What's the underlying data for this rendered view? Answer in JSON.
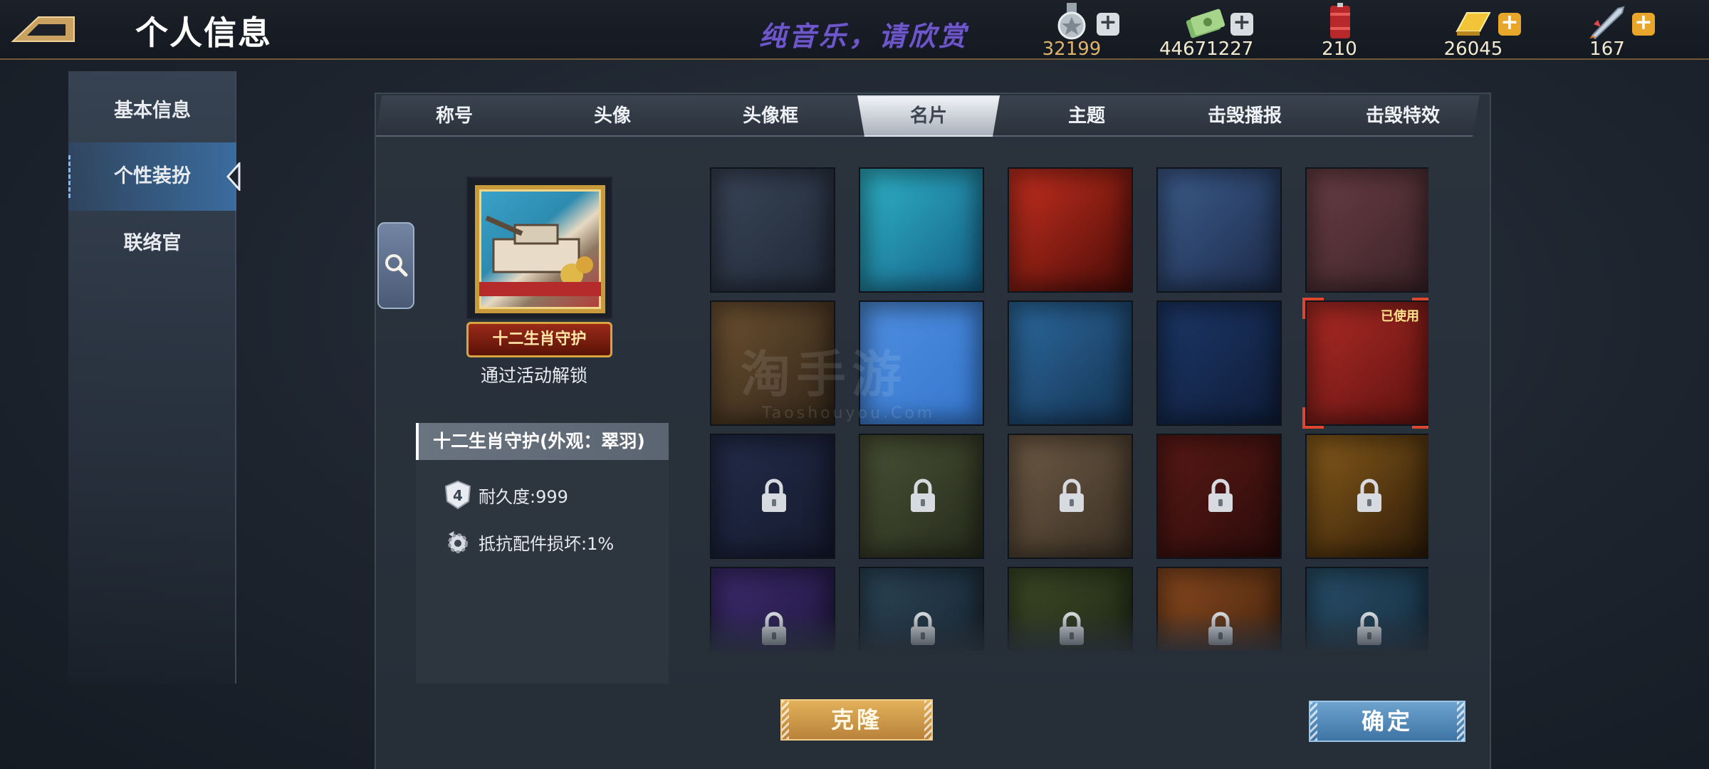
{
  "header": {
    "title": "个人信息",
    "music_text": "纯音乐，请欣赏",
    "resources": [
      {
        "icon": "medal-icon",
        "value": "32199",
        "value_color": "#e0b36a"
      },
      {
        "icon": "cash-icon",
        "value": "44671227",
        "value_color": "#f3ead0"
      },
      {
        "icon": "fuel-barrel-icon",
        "value": "210",
        "value_color": "#f3ead0"
      },
      {
        "icon": "gold-bar-icon",
        "value": "26045",
        "value_color": "#f3ead0"
      },
      {
        "icon": "rocket-icon",
        "value": "167",
        "value_color": "#f3ead0"
      }
    ]
  },
  "sidebar": {
    "items": [
      {
        "label": "基本信息",
        "active": false
      },
      {
        "label": "个性装扮",
        "active": true
      },
      {
        "label": "联络官",
        "active": false
      }
    ]
  },
  "tabs": [
    {
      "label": "称号",
      "active": false
    },
    {
      "label": "头像",
      "active": false
    },
    {
      "label": "头像框",
      "active": false
    },
    {
      "label": "名片",
      "active": true
    },
    {
      "label": "主题",
      "active": false
    },
    {
      "label": "击毁播报",
      "active": false
    },
    {
      "label": "击毁特效",
      "active": false
    }
  ],
  "preview": {
    "banner_text": "十二生肖守护",
    "unlock_text": "通过活动解锁"
  },
  "info": {
    "title": "十二生肖守护(外观：翠羽)",
    "stats": [
      {
        "icon": "durability-shield-icon",
        "text": "耐久度:999"
      },
      {
        "icon": "gear-damage-icon",
        "text": "抵抗配件损坏:1%"
      }
    ]
  },
  "cards": [
    {
      "name": "hexagon-steel",
      "locked": false,
      "colors": [
        "#3a4658",
        "#1f2836"
      ]
    },
    {
      "name": "ocean",
      "locked": false,
      "colors": [
        "#2fb5c9",
        "#155e86"
      ]
    },
    {
      "name": "red-flag",
      "locked": false,
      "colors": [
        "#c8301f",
        "#4a0c08"
      ]
    },
    {
      "name": "blue-checker",
      "locked": false,
      "colors": [
        "#3e5d8d",
        "#1b2a48"
      ]
    },
    {
      "name": "purple-swirl",
      "locked": false,
      "colors": [
        "#6a3f45",
        "#3a2228"
      ]
    },
    {
      "name": "brown-stripes",
      "locked": false,
      "colors": [
        "#6f5232",
        "#2f2418"
      ]
    },
    {
      "name": "blue-pattern",
      "locked": false,
      "colors": [
        "#4f8fe0",
        "#3577cf"
      ]
    },
    {
      "name": "blue-floral",
      "locked": false,
      "colors": [
        "#2c6a9e",
        "#153353"
      ]
    },
    {
      "name": "navy-wave",
      "locked": false,
      "colors": [
        "#1c3766",
        "#0f1d3a"
      ]
    },
    {
      "name": "red-cloud",
      "locked": false,
      "used": true,
      "used_label": "已使用",
      "colors": [
        "#b02b25",
        "#5d1210"
      ]
    },
    {
      "name": "star-dark",
      "locked": true,
      "colors": [
        "#232c4a",
        "#141a2e"
      ]
    },
    {
      "name": "camo-green",
      "locked": true,
      "colors": [
        "#4a5236",
        "#262b1c"
      ]
    },
    {
      "name": "tan-stripes",
      "locked": true,
      "colors": [
        "#6e5b45",
        "#3a2f24"
      ]
    },
    {
      "name": "dark-red",
      "locked": true,
      "colors": [
        "#5b1a17",
        "#2a0b0a"
      ]
    },
    {
      "name": "amber-glow",
      "locked": true,
      "colors": [
        "#8a5d1b",
        "#2c1a08"
      ]
    },
    {
      "name": "purple-night",
      "locked": true,
      "colors": [
        "#3c2b6e",
        "#1d153a"
      ]
    },
    {
      "name": "helicopter",
      "locked": true,
      "colors": [
        "#2c4658",
        "#14212c"
      ]
    },
    {
      "name": "green-leaf",
      "locked": true,
      "colors": [
        "#3c4a26",
        "#1d2412"
      ]
    },
    {
      "name": "autumn",
      "locked": true,
      "colors": [
        "#8a4a1f",
        "#3d1f0c"
      ]
    },
    {
      "name": "frost",
      "locked": true,
      "colors": [
        "#28506a",
        "#142838"
      ]
    }
  ],
  "watermark": {
    "text": "淘手游",
    "sub": "Taoshouyou.Com"
  },
  "buttons": {
    "clone": "克隆",
    "confirm": "确定"
  }
}
